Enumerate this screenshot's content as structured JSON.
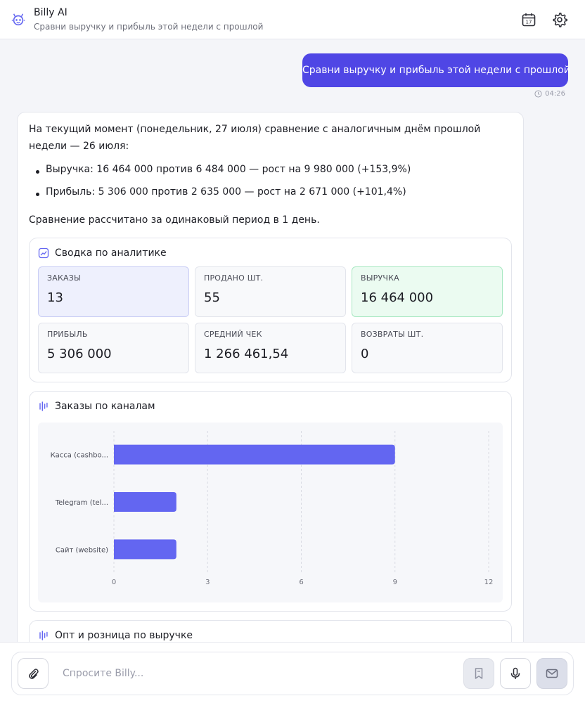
{
  "header": {
    "title": "Billy AI",
    "subtitle": "Сравни выручку и прибыль этой недели с прошлой",
    "icons": [
      "bot-logo",
      "calendar-icon",
      "gear-icon"
    ],
    "calendar_day": "17"
  },
  "chat": {
    "user_message": "Сравни выручку и прибыль этой недели с прошлой",
    "user_time": "04:26",
    "bot": {
      "intro": "На текущий момент (понедельник, 27 июля) сравнение с аналогичным днём прошлой недели — 26 июля:",
      "bullets": [
        "Выручка: 16 464 000 против 6 484 000 — рост на 9 980 000 (+153,9%)",
        "Прибыль: 5 306 000 против 2 635 000 — рост на 2 671 000 (+101,4%)"
      ],
      "note": "Сравнение рассчитано за одинаковый период в 1 день."
    }
  },
  "summary": {
    "title": "Сводка по аналитике",
    "stats": [
      {
        "label": "ЗАКАЗЫ",
        "value": "13"
      },
      {
        "label": "ПРОДАНО ШТ.",
        "value": "55"
      },
      {
        "label": "ВЫРУЧКА",
        "value": "16 464 000"
      },
      {
        "label": "ПРИБЫЛЬ",
        "value": "5 306 000"
      },
      {
        "label": "СРЕДНИЙ ЧЕК",
        "value": "1 266 461,54"
      },
      {
        "label": "ВОЗВРАТЫ ШТ.",
        "value": "0"
      }
    ]
  },
  "chart_data": {
    "type": "bar",
    "orientation": "horizontal",
    "title": "Заказы по каналам",
    "categories": [
      "Касса (cashbo...",
      "Telegram (tel...",
      "Сайт (website)"
    ],
    "values": [
      9,
      2,
      2
    ],
    "xlim": [
      0,
      12
    ],
    "xticks": [
      "0",
      "3",
      "6",
      "9",
      "12"
    ],
    "grid": true,
    "bar_color": "#6366f1"
  },
  "next_panel": {
    "title": "Опт и розница по выручке"
  },
  "composer": {
    "placeholder": "Спросите Billy..."
  },
  "colors": {
    "accent": "#4f46e5",
    "bar": "#6366f1",
    "stat_blue": "#eef0fd",
    "stat_green": "#ebfbf1"
  }
}
